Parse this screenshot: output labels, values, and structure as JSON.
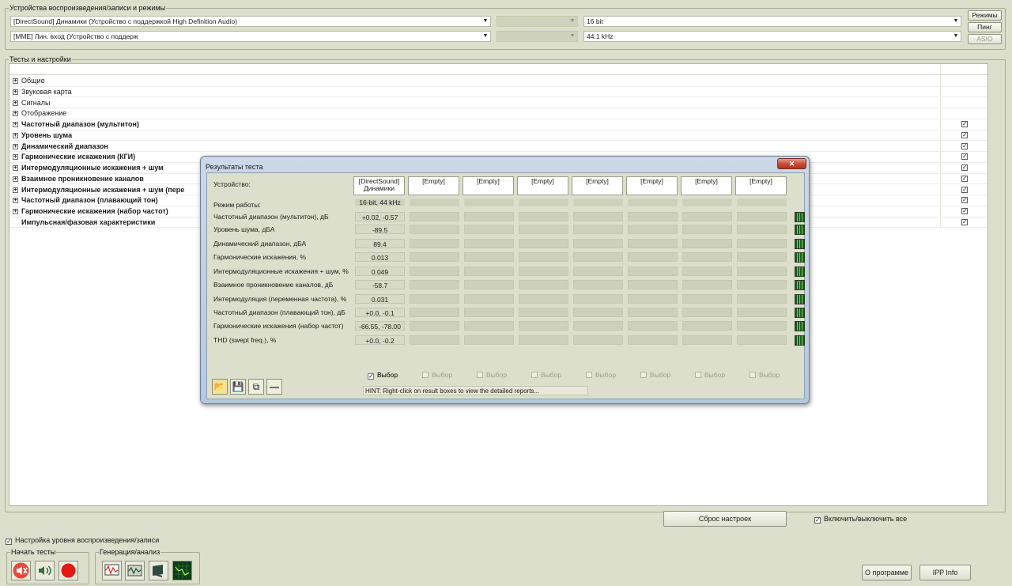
{
  "devices": {
    "legend": "Устройства воспроизведения/записи и режимы",
    "playback_device": "[DirectSound] Динамики (Устройство с поддержкой High Definition Audio)",
    "recording_device": "[MME] Лин. вход (Устройство с поддерж",
    "bit_depth": "16 bit",
    "sample_rate": "44.1 kHz",
    "buttons": {
      "modes": "Режимы",
      "ping": "Пинг",
      "asio": "ASIO"
    }
  },
  "tests": {
    "legend": "Тесты и настройки",
    "items": [
      {
        "label": "Общие",
        "bold": false,
        "checked": null
      },
      {
        "label": "Звуковая карта",
        "bold": false,
        "checked": null
      },
      {
        "label": "Сигналы",
        "bold": false,
        "checked": null
      },
      {
        "label": "Отображение",
        "bold": false,
        "checked": null
      },
      {
        "label": "Частотный диапазон (мультитон)",
        "bold": true,
        "checked": true
      },
      {
        "label": "Уровень шума",
        "bold": true,
        "checked": true
      },
      {
        "label": "Динамический диапазон",
        "bold": true,
        "checked": true
      },
      {
        "label": "Гармонические искажения (КГИ)",
        "bold": true,
        "checked": true
      },
      {
        "label": "Интермодуляционные искажения + шум",
        "bold": true,
        "checked": true
      },
      {
        "label": "Взаимное проникновение каналов",
        "bold": true,
        "checked": true
      },
      {
        "label": "Интермодуляционные искажения + шум (пере",
        "bold": true,
        "checked": true
      },
      {
        "label": "Частотный диапазон (плавающий тон)",
        "bold": true,
        "checked": true
      },
      {
        "label": "Гармонические искажения (набор частот)",
        "bold": true,
        "checked": true
      },
      {
        "label": "Импульсная/фазовая характеристики",
        "bold": true,
        "checked": true
      }
    ]
  },
  "dialog": {
    "title": "Результаты теста",
    "close_glyph": "✕",
    "device_label": "Устройство:",
    "mode_label": "Режим работы:",
    "columns": [
      {
        "line1": "[DirectSound]",
        "line2": "Динамики",
        "mode": "16-bit, 44 kHz"
      },
      {
        "line1": "[Empty]",
        "line2": "",
        "mode": ""
      },
      {
        "line1": "[Empty]",
        "line2": "",
        "mode": ""
      },
      {
        "line1": "[Empty]",
        "line2": "",
        "mode": ""
      },
      {
        "line1": "[Empty]",
        "line2": "",
        "mode": ""
      },
      {
        "line1": "[Empty]",
        "line2": "",
        "mode": ""
      },
      {
        "line1": "[Empty]",
        "line2": "",
        "mode": ""
      },
      {
        "line1": "[Empty]",
        "line2": "",
        "mode": ""
      }
    ],
    "rows": [
      {
        "label": "Частотный диапазон (мультитон), дБ",
        "value": "+0.02, -0.57"
      },
      {
        "label": "Уровень шума, дБА",
        "value": "-89.5"
      },
      {
        "label": "Динамический диапазон, дБА",
        "value": "89.4"
      },
      {
        "label": "Гармонические искажения, %",
        "value": "0.013"
      },
      {
        "label": "Интермодуляционные искажения + шум, %",
        "value": "0.049"
      },
      {
        "label": "Взаимное проникновение каналов, дБ",
        "value": "-58.7"
      },
      {
        "label": "Интермодуляция (переменная частота), %",
        "value": "0.031"
      },
      {
        "label": "Частотный диапазон (плавающий тон), дБ",
        "value": "+0.0, -0.1"
      },
      {
        "label": "Гармонические искажения (набор частот)",
        "value": "-66.55, -78.00"
      },
      {
        "label": "THD (swept freq.), %",
        "value": "+0.0, -0.2"
      }
    ],
    "select_label": "Выбор",
    "selects_checked": [
      true,
      false,
      false,
      false,
      false,
      false,
      false,
      false
    ],
    "hint": "HINT: Right-click on result boxes to view the detailed reports..."
  },
  "footer": {
    "reset_settings": "Сброс настроек",
    "toggle_all": "Включить/выключить все",
    "toggle_all_checked": true,
    "level_setting": "Настройка уровня воспроизведения/записи",
    "level_setting_checked": true,
    "start_tests_legend": "Начать тесты",
    "generation_legend": "Генерация/анализ",
    "about": "О программе",
    "ipp_info": "IPP Info"
  }
}
